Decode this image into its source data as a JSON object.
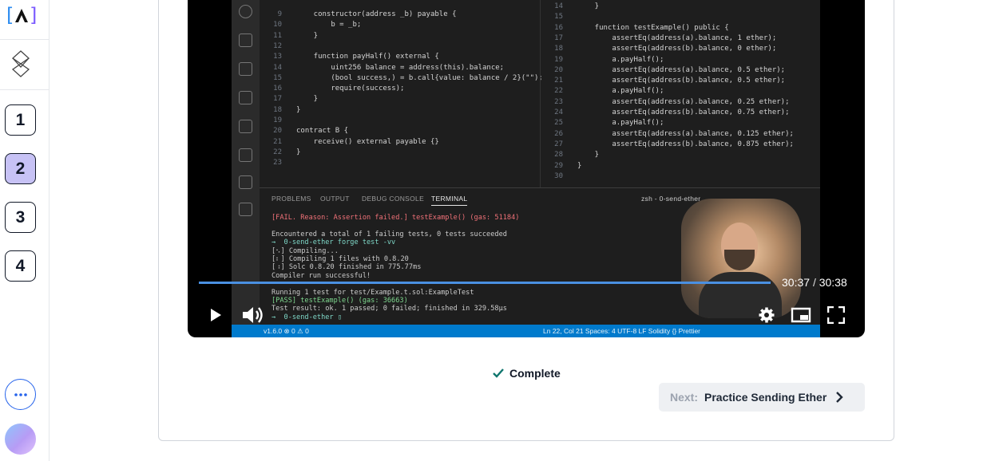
{
  "sidebar": {
    "logo_text": "[A]",
    "steps": [
      {
        "label": "1",
        "active": false
      },
      {
        "label": "2",
        "active": true
      },
      {
        "label": "3",
        "active": false
      },
      {
        "label": "4",
        "active": false
      }
    ],
    "more_icon": "ellipsis-icon",
    "accent": "#2563eb",
    "active_step_color": "#c7c2f5"
  },
  "video": {
    "time_current": "30:37",
    "time_separator": "/",
    "time_total": "30:38",
    "progress": 0.9995,
    "progress_color": "#4a90e2",
    "screen": {
      "left_code": [
        {
          "n": "9",
          "t": "    constructor(address _b) payable {"
        },
        {
          "n": "10",
          "t": "        b = _b;"
        },
        {
          "n": "11",
          "t": "    }"
        },
        {
          "n": "12",
          "t": ""
        },
        {
          "n": "13",
          "t": "    function payHalf() external {"
        },
        {
          "n": "14",
          "t": "        uint256 balance = address(this).balance;"
        },
        {
          "n": "15",
          "t": "        (bool success,) = b.call{value: balance / 2}(\"\");"
        },
        {
          "n": "16",
          "t": "        require(success);"
        },
        {
          "n": "17",
          "t": "    }"
        },
        {
          "n": "18",
          "t": "}"
        },
        {
          "n": "19",
          "t": ""
        },
        {
          "n": "20",
          "t": "contract B {"
        },
        {
          "n": "21",
          "t": "    receive() external payable {}"
        },
        {
          "n": "22",
          "t": "}"
        },
        {
          "n": "23",
          "t": ""
        }
      ],
      "right_code": [
        {
          "n": "14",
          "t": "    }"
        },
        {
          "n": "15",
          "t": ""
        },
        {
          "n": "16",
          "t": "    function testExample() public {"
        },
        {
          "n": "17",
          "t": "        assertEq(address(a).balance, 1 ether);"
        },
        {
          "n": "18",
          "t": "        assertEq(address(b).balance, 0 ether);"
        },
        {
          "n": "19",
          "t": "        a.payHalf();"
        },
        {
          "n": "20",
          "t": "        assertEq(address(a).balance, 0.5 ether);"
        },
        {
          "n": "21",
          "t": "        assertEq(address(b).balance, 0.5 ether);"
        },
        {
          "n": "22",
          "t": "        a.payHalf();"
        },
        {
          "n": "23",
          "t": "        assertEq(address(a).balance, 0.25 ether);"
        },
        {
          "n": "24",
          "t": "        assertEq(address(b).balance, 0.75 ether);"
        },
        {
          "n": "25",
          "t": "        a.payHalf();"
        },
        {
          "n": "26",
          "t": "        assertEq(address(a).balance, 0.125 ether);"
        },
        {
          "n": "27",
          "t": "        assertEq(address(b).balance, 0.875 ether);"
        },
        {
          "n": "28",
          "t": "    }"
        },
        {
          "n": "29",
          "t": "}"
        },
        {
          "n": "30",
          "t": ""
        }
      ],
      "panel_tabs": [
        "PROBLEMS",
        "OUTPUT",
        "DEBUG CONSOLE",
        "TERMINAL"
      ],
      "terminal_title": "zsh - 0-send-ether",
      "terminal_lines": [
        "[FAIL. Reason: Assertion failed.] testExample() (gas: 51184)",
        "",
        "Encountered a total of 1 failing tests, 0 tests succeeded",
        "→  0-send-ether forge test -vv",
        "[⠢] Compiling...",
        "[⠆] Compiling 1 files with 0.8.20",
        "[⠰] Solc 0.8.20 finished in 775.77ms",
        "Compiler run successful!",
        "",
        "Running 1 test for test/Example.t.sol:ExampleTest",
        "[PASS] testExample() (gas: 36663)",
        "Test result: ok. 1 passed; 0 failed; finished in 329.58µs",
        "→  0-send-ether ▯"
      ],
      "status_left": "v1.6.0  ⊗ 0 ⚠ 0",
      "status_right": "Ln 22, Col 21   Spaces: 4   UTF-8   LF   Solidity   {} Prettier"
    }
  },
  "complete": {
    "label": "Complete",
    "icon": "check-icon",
    "color": "#0f766e"
  },
  "next": {
    "prefix": "Next:",
    "title": "Practice Sending Ether",
    "icon": "chevron-right-icon"
  }
}
